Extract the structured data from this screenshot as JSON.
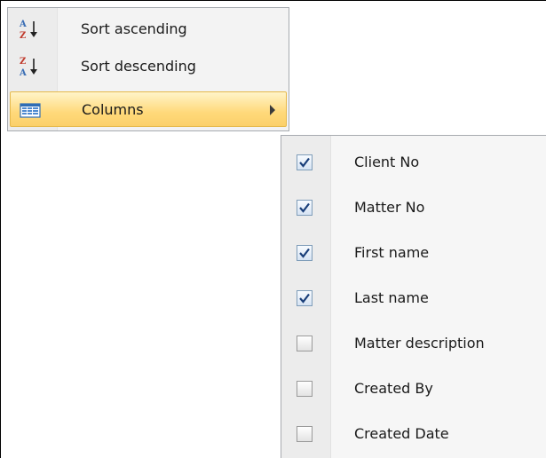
{
  "context_menu": {
    "items": [
      {
        "label": "Sort ascending",
        "icon": "sort-ascending-icon"
      },
      {
        "label": "Sort descending",
        "icon": "sort-descending-icon"
      },
      {
        "label": "Columns",
        "icon": "columns-icon",
        "highlighted": true,
        "has_submenu": true
      }
    ]
  },
  "columns_submenu": {
    "items": [
      {
        "label": "Client No",
        "checked": true
      },
      {
        "label": "Matter No",
        "checked": true
      },
      {
        "label": "First name",
        "checked": true
      },
      {
        "label": "Last name",
        "checked": true
      },
      {
        "label": "Matter description",
        "checked": false
      },
      {
        "label": "Created By",
        "checked": false
      },
      {
        "label": "Created Date",
        "checked": false
      }
    ]
  },
  "colors": {
    "highlight": "#ffd97a",
    "check_mark": "#1a3f7a",
    "menu_background": "#f3f3f3"
  }
}
